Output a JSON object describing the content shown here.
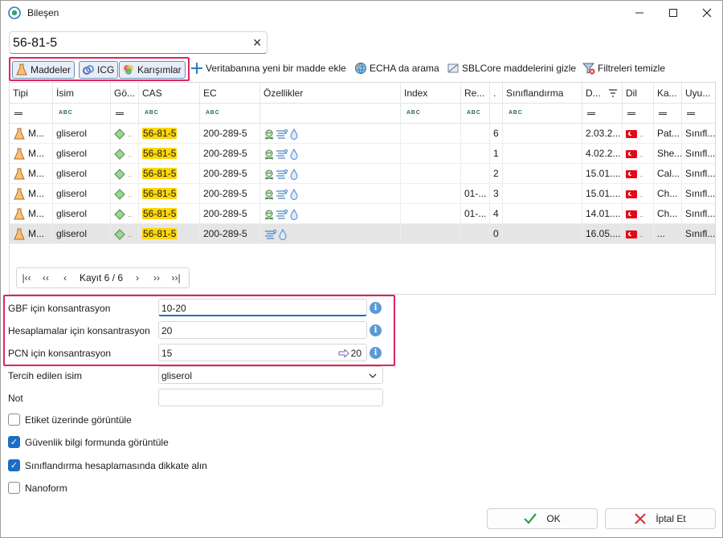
{
  "window": {
    "title": "Bileşen"
  },
  "search": {
    "value": "56-81-5"
  },
  "toolbar": {
    "toggle_maddeler": "Maddeler",
    "toggle_icg": "ICG",
    "toggle_karisimlar": "Karışımlar",
    "add_new": "Veritabanına yeni bir madde ekle",
    "echa_search": "ECHA da arama",
    "hide_sblcore": "SBLCore maddelerini gizle",
    "clear_filters": "Filtreleri temizle"
  },
  "grid": {
    "columns": [
      "Tipi",
      "İsim",
      "Gö...",
      "CAS",
      "EC",
      "Özellikler",
      "Index",
      "Re...",
      ".",
      "Sınıflandırma",
      "D...",
      "Dil",
      "Ka...",
      "Uyu..."
    ],
    "rows": [
      {
        "type": "M...",
        "name": "gliserol",
        "cas": "56-81-5",
        "ec": "200-289-5",
        "index": "",
        "re": "",
        "dot": "6",
        "class": "",
        "date": "2.03.2...",
        "ka": "Pat...",
        "uyu": "Sınıfl..."
      },
      {
        "type": "M...",
        "name": "gliserol",
        "cas": "56-81-5",
        "ec": "200-289-5",
        "index": "",
        "re": "",
        "dot": "1",
        "class": "",
        "date": "4.02.2...",
        "ka": "She...",
        "uyu": "Sınıfl..."
      },
      {
        "type": "M...",
        "name": "gliserol",
        "cas": "56-81-5",
        "ec": "200-289-5",
        "index": "",
        "re": "",
        "dot": "2",
        "class": "",
        "date": "15.01....",
        "ka": "Cal...",
        "uyu": "Sınıfl..."
      },
      {
        "type": "M...",
        "name": "gliserol",
        "cas": "56-81-5",
        "ec": "200-289-5",
        "index": "",
        "re": "01-...",
        "dot": "3",
        "class": "",
        "date": "15.01....",
        "ka": "Ch...",
        "uyu": "Sınıfl..."
      },
      {
        "type": "M...",
        "name": "gliserol",
        "cas": "56-81-5",
        "ec": "200-289-5",
        "index": "",
        "re": "01-...",
        "dot": "4",
        "class": "",
        "date": "14.01....",
        "ka": "Ch...",
        "uyu": "Sınıfl..."
      },
      {
        "type": "M...",
        "name": "gliserol",
        "cas": "56-81-5",
        "ec": "200-289-5",
        "index": "",
        "re": "",
        "dot": "0",
        "class": "",
        "date": "16.05....",
        "ka": "...",
        "uyu": "Sınıfl..."
      }
    ]
  },
  "pager": {
    "text": "Kayıt 6 / 6"
  },
  "form": {
    "gbf_label": "GBF için konsantrasyon",
    "gbf_value": "10-20",
    "calc_label": "Hesaplamalar için konsantrasyon",
    "calc_value": "20",
    "pcn_label": "PCN için konsantrasyon",
    "pcn_value": "15",
    "pcn_arrow_value": "20",
    "pref_label": "Tercih edilen isim",
    "pref_value": "gliserol",
    "note_label": "Not",
    "note_value": "",
    "info": "i"
  },
  "checkboxes": [
    {
      "label": "Etiket üzerinde görüntüle",
      "checked": false
    },
    {
      "label": "Güvenlik bilgi formunda görüntüle",
      "checked": true
    },
    {
      "label": "Sınıflandırma hesaplamasında dikkate alın",
      "checked": true
    },
    {
      "label": "Nanoform",
      "checked": false
    }
  ],
  "buttons": {
    "ok": "OK",
    "cancel": "İptal Et"
  },
  "colors": {
    "highlight_border": "#e0245e",
    "cas_highlight": "#ffd60a",
    "accent": "#1a6fc4"
  }
}
